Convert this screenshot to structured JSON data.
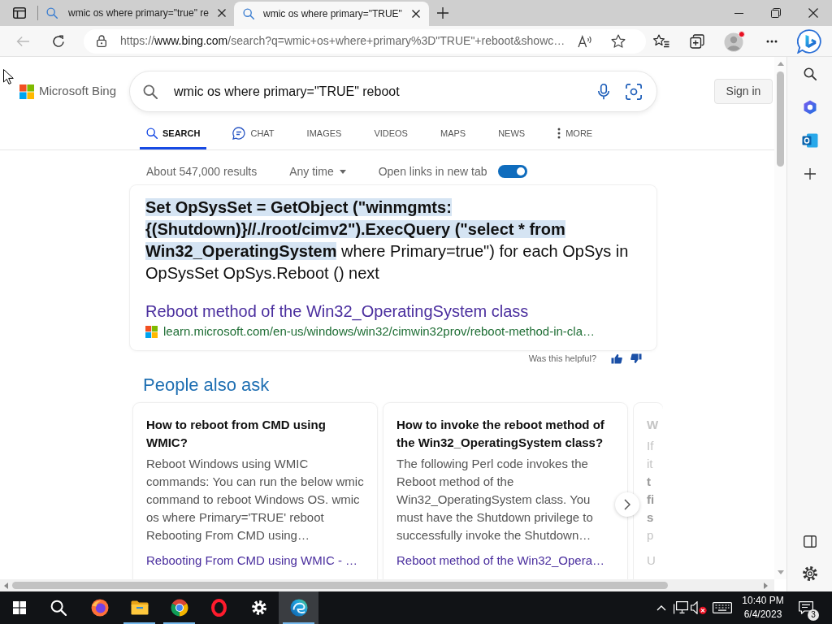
{
  "browser": {
    "tabs": [
      {
        "title": "wmic os where primary=\"true\" re",
        "selected": false
      },
      {
        "title": "wmic os where primary=\"TRUE\"",
        "selected": true
      }
    ],
    "back_disabled": true,
    "address": {
      "scheme": "https://",
      "host": "www.bing.com",
      "path": "/search?q=wmic+os+where+primary%3D\"TRUE\"+reboot&showc…"
    }
  },
  "page": {
    "logo": "Microsoft Bing",
    "query": "wmic os where primary=\"TRUE\" reboot",
    "sign_in": "Sign in",
    "nav": [
      {
        "label": "SEARCH",
        "kind": "search",
        "selected": true
      },
      {
        "label": "CHAT",
        "kind": "chat",
        "selected": false
      },
      {
        "label": "IMAGES",
        "kind": "text",
        "selected": false
      },
      {
        "label": "VIDEOS",
        "kind": "text",
        "selected": false
      },
      {
        "label": "MAPS",
        "kind": "text",
        "selected": false
      },
      {
        "label": "NEWS",
        "kind": "text",
        "selected": false
      },
      {
        "label": "MORE",
        "kind": "more",
        "selected": false
      }
    ],
    "results_count": "About 547,000 results",
    "time_filter": "Any time",
    "new_tab_toggle": {
      "label": "Open links in new tab",
      "on": true
    },
    "answer": {
      "text": "**Set OpSysSet = GetObject (\"winmgmts: {(Shutdown)}//./root/cimv2\").ExecQuery (\"select * from Win32_OperatingSystem** where Primary=true\") for each OpSys in OpSysSet OpSys.Reboot () next",
      "link": "Reboot method of the Win32_OperatingSystem class",
      "url": "learn.microsoft.com/en-us/windows/win32/cimwin32prov/reboot-method-in-cla…"
    },
    "feedback": "Was this helpful?",
    "people_also_ask": {
      "title": "People also ask",
      "cards": [
        {
          "question": "How to reboot from CMD using WMIC?",
          "answer": "Reboot Windows using WMIC commands: You can run the below wmic command to reboot Windows OS. wmic os where Primary='TRUE' reboot Rebooting From CMD using…",
          "link": "Rebooting From CMD using WMIC - …"
        },
        {
          "question": "How to invoke the reboot method of the Win32_OperatingSystem class?",
          "answer": "The following Perl code invokes the Reboot method of the Win32_OperatingSystem class. You must have the Shutdown privilege to successfully invoke the Shutdown…",
          "link": "Reboot method of the Win32_Opera…"
        }
      ],
      "cut_card": {
        "question": "W",
        "answer": "If it **t fi s** p",
        "link": "U"
      }
    }
  },
  "taskbar": {
    "apps": [
      {
        "kind": "firefox",
        "running": false,
        "selected": false
      },
      {
        "kind": "files",
        "running": true,
        "selected": false
      },
      {
        "kind": "chrome",
        "running": true,
        "selected": false
      },
      {
        "kind": "opera",
        "running": false,
        "selected": false
      },
      {
        "kind": "settings",
        "running": false,
        "selected": false
      },
      {
        "kind": "edge",
        "running": true,
        "selected": true
      }
    ],
    "time": "10:40 PM",
    "date": "6/4/2023",
    "notifications": "3"
  }
}
